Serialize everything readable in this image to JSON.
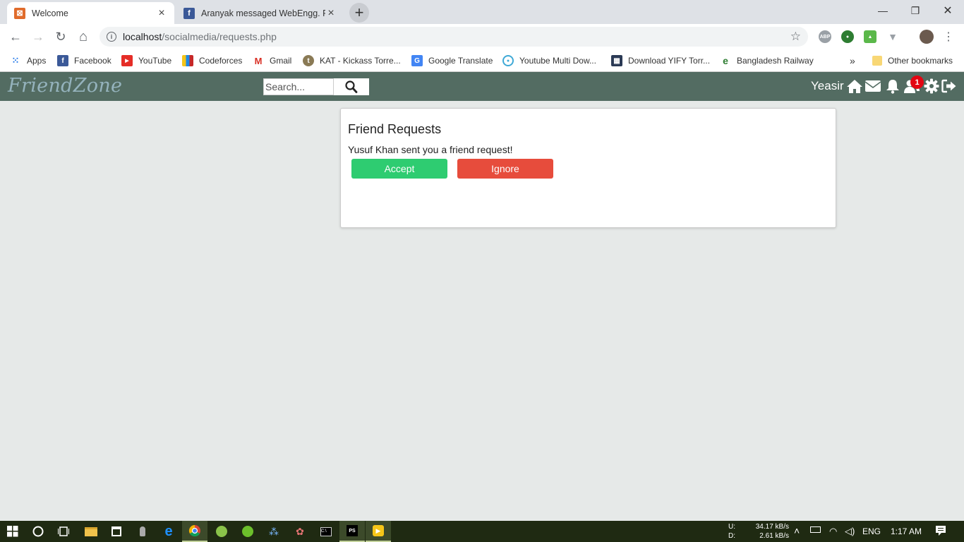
{
  "browser": {
    "tabs": [
      {
        "label": "Welcome",
        "icon": "xampp-icon",
        "active": true
      },
      {
        "label": "Aranyak messaged WebEngg. Pro",
        "icon": "facebook-icon",
        "active": false
      }
    ],
    "new_tab_label": "+",
    "window_controls": {
      "minimize": "—",
      "maximize": "❐",
      "close": "✕"
    },
    "nav": {
      "back": "←",
      "forward": "→",
      "reload": "↻",
      "home": "⌂"
    },
    "url_host": "localhost",
    "url_path": "/socialmedia/requests.php",
    "bookmarks": [
      {
        "label": "Apps",
        "icon": "apps-grid-icon"
      },
      {
        "label": "Facebook",
        "icon": "facebook-icon"
      },
      {
        "label": "YouTube",
        "icon": "youtube-icon"
      },
      {
        "label": "Codeforces",
        "icon": "codeforces-icon"
      },
      {
        "label": "Gmail",
        "icon": "gmail-icon"
      },
      {
        "label": "KAT - Kickass Torre...",
        "icon": "kat-icon"
      },
      {
        "label": "Google Translate",
        "icon": "google-translate-icon"
      },
      {
        "label": "Youtube Multi Dow...",
        "icon": "download-icon"
      },
      {
        "label": "Download YIFY Torr...",
        "icon": "film-icon"
      },
      {
        "label": "Bangladesh Railway",
        "icon": "railway-icon"
      }
    ],
    "bookmarks_overflow": "»",
    "other_bookmarks": "Other bookmarks"
  },
  "app": {
    "logo": "FriendZone",
    "search_placeholder": "Search...",
    "username": "Yeasir",
    "friend_request_count": "1"
  },
  "requests": {
    "title": "Friend Requests",
    "message": "Yusuf Khan sent you a friend request!",
    "accept_label": "Accept",
    "ignore_label": "Ignore"
  },
  "taskbar": {
    "net_up_label": "U:",
    "net_up_value": "34.17 kB/s",
    "net_down_label": "D:",
    "net_down_value": "2.61 kB/s",
    "language": "ENG",
    "time": "1:17 AM"
  },
  "colors": {
    "navbar": "#536c62",
    "logo": "#95b3bd",
    "accept": "#2ecc71",
    "ignore": "#e74c3c",
    "badge": "#e30613",
    "page_bg": "#e6e9e8"
  }
}
